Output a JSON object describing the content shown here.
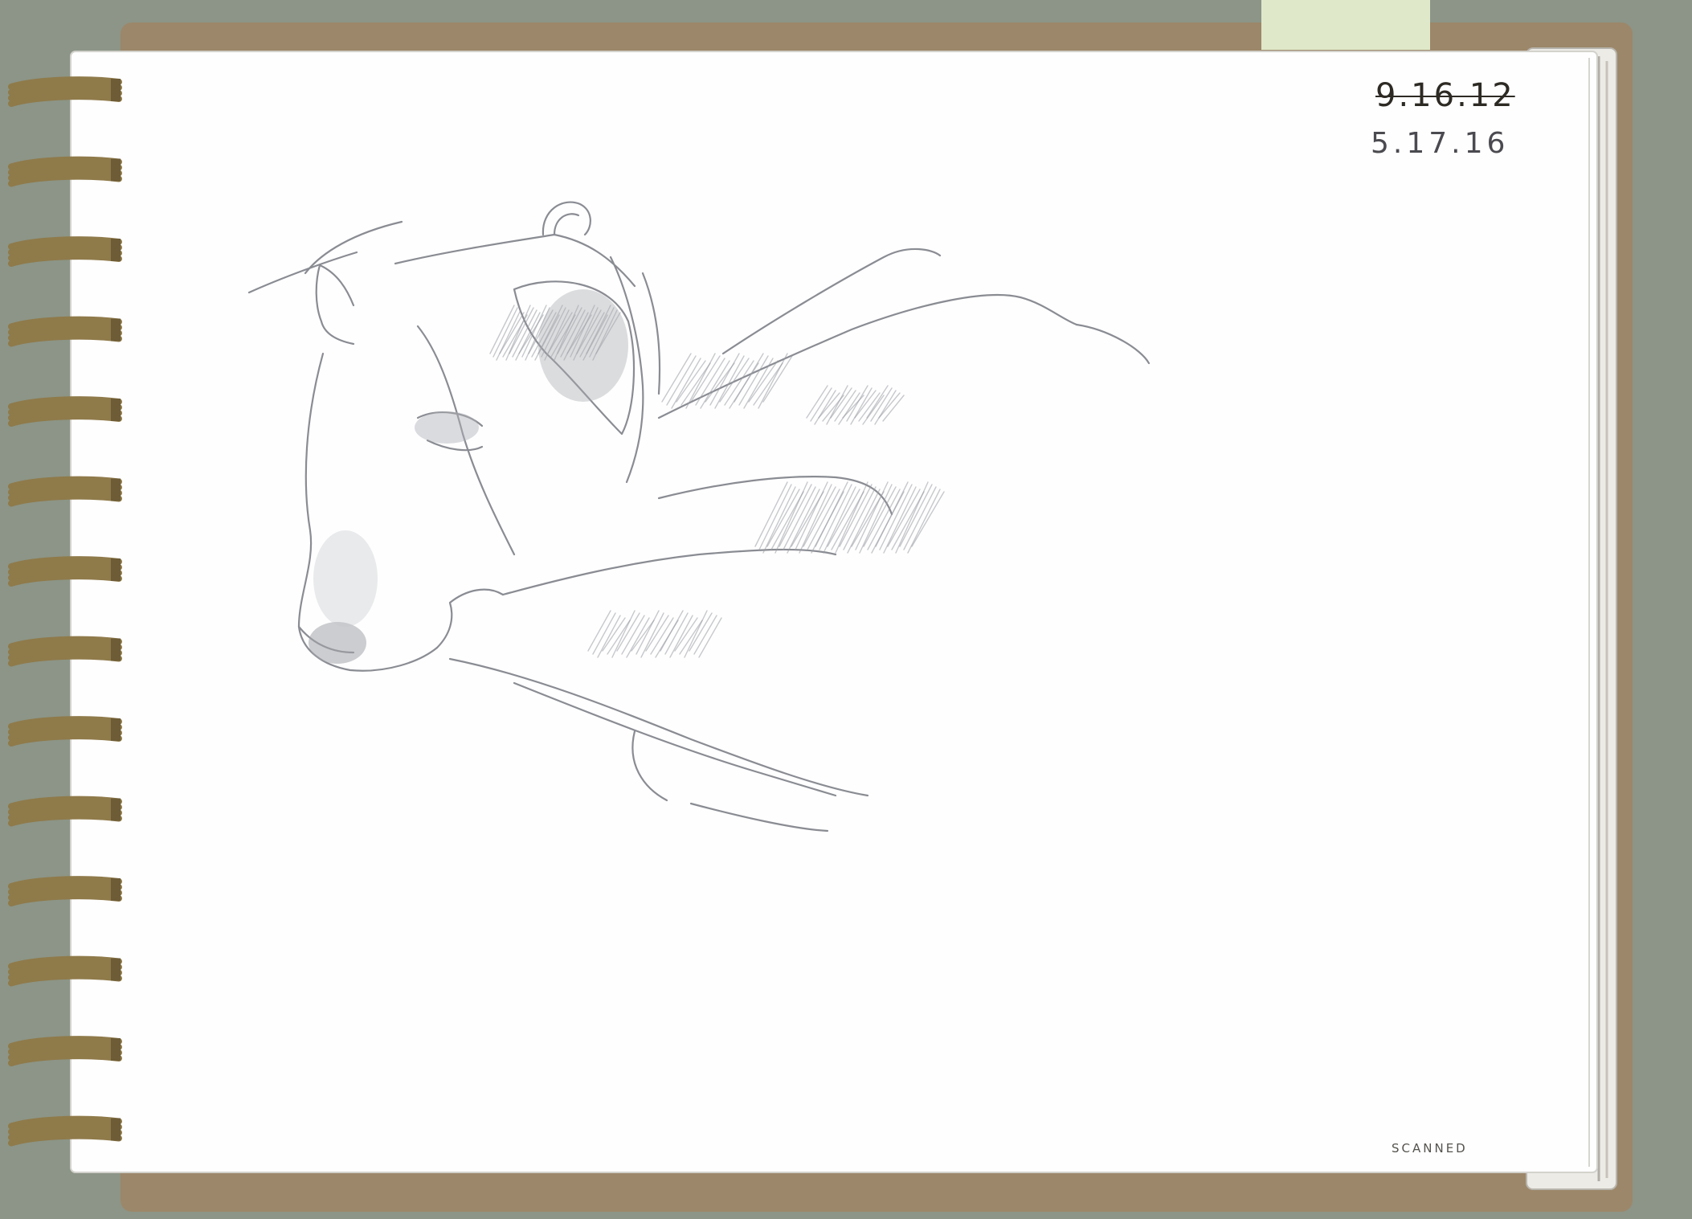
{
  "notebook": {
    "annotations": {
      "original_date": "9.16.12",
      "revised_date": "5.17.16",
      "stamp": "SCANNED"
    },
    "colors": {
      "background": "#8c9587",
      "cover": "#9c876a",
      "paper": "#fefefe",
      "spiral_binding": "#8f7a4a",
      "pencil": "#8a8c93"
    },
    "picture": "pencil sketch of a sleeping dog resting its head on a pillow"
  }
}
